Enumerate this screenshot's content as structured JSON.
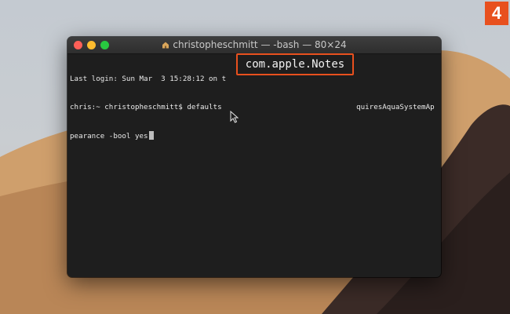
{
  "step": {
    "number": "4",
    "color": "#e8501e"
  },
  "window": {
    "title": "christopheschmitt — -bash — 80×24",
    "title_icon": "home-folder-icon",
    "background": "#1e1e1e"
  },
  "terminal": {
    "lines": [
      "Last login: Sun Mar  3 15:28:12 on t",
      "chris:~ christopheschmitt$ defaults                               quiresAquaSystemAp",
      "pearance -bool yes"
    ],
    "cursor": "block-cursor"
  },
  "callout": {
    "text": "com.apple.Notes",
    "border_color": "#e8501e"
  },
  "pointer": "mouse-pointer-icon"
}
